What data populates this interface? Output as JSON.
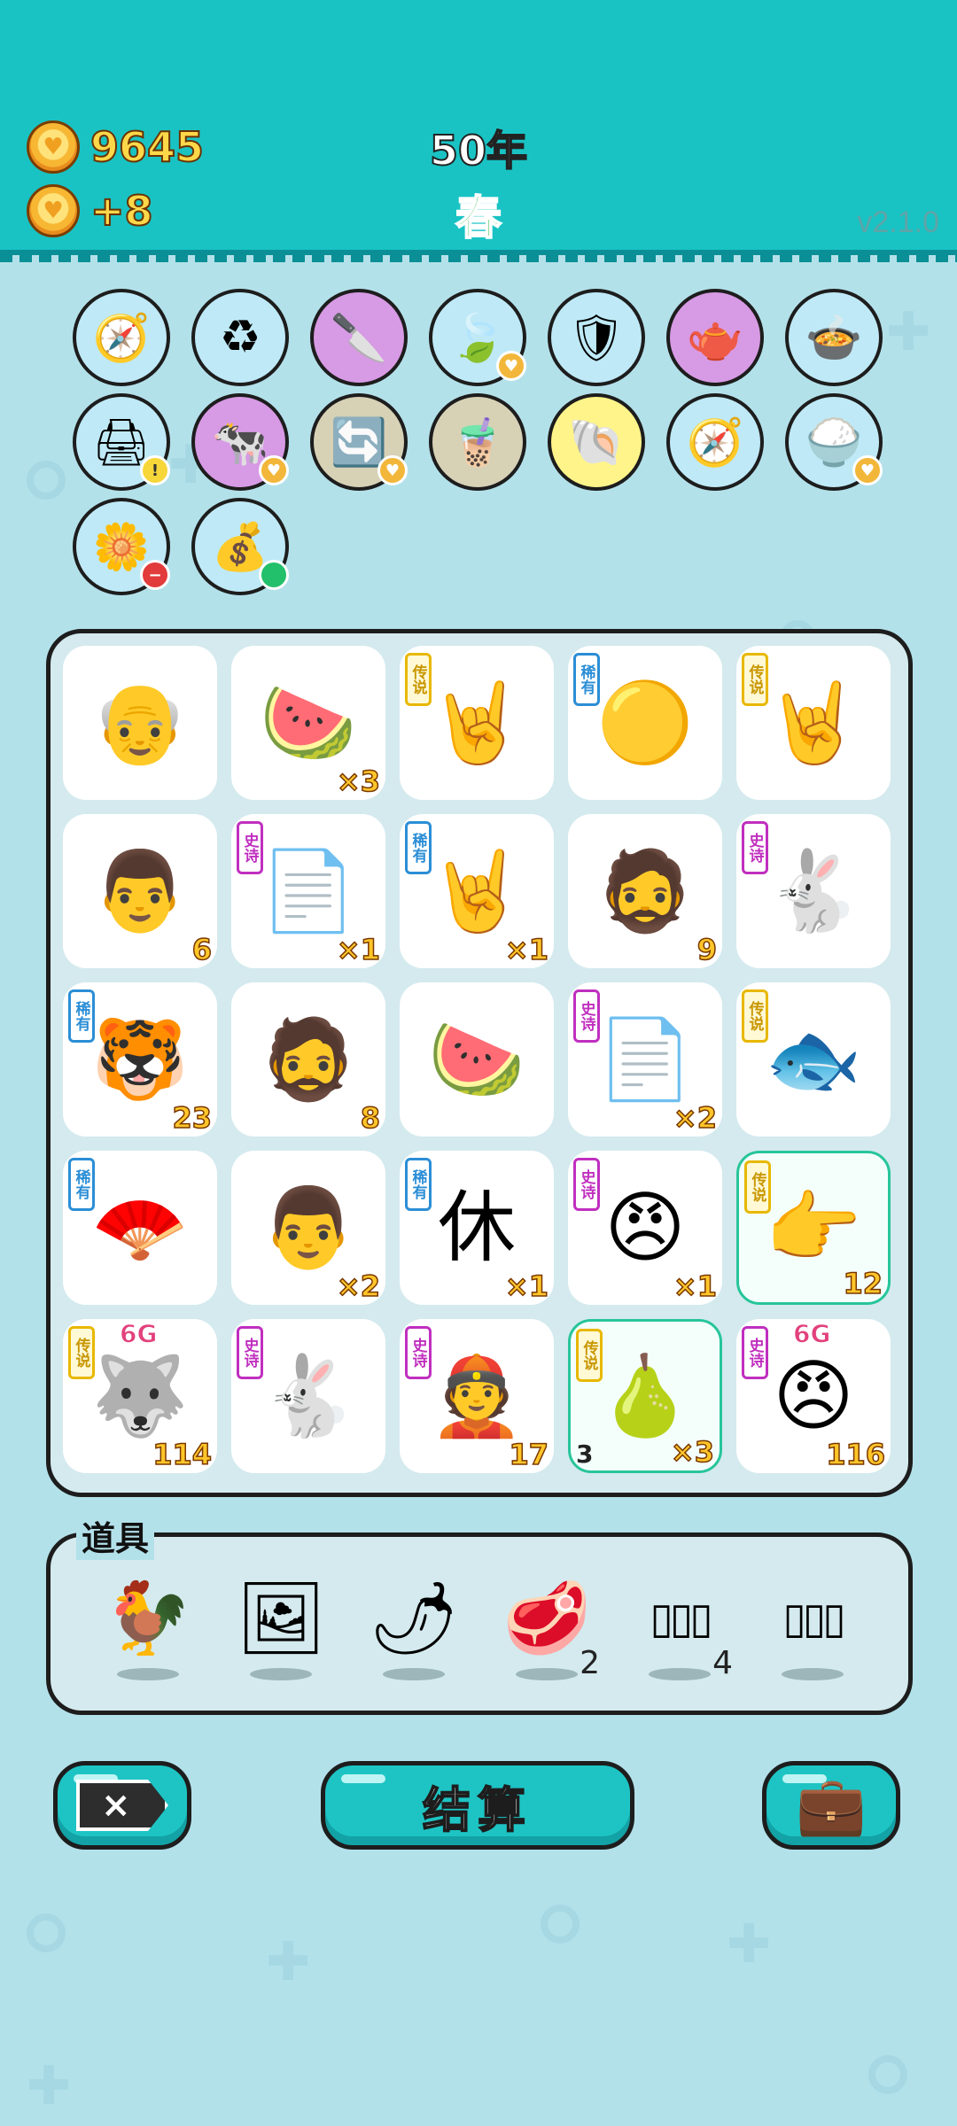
{
  "header": {
    "coins": "9645",
    "income": "+8",
    "year": "50年",
    "season": "春",
    "version": "v2.1.0"
  },
  "tools_row1": [
    {
      "icon": "compass-icon",
      "glyph": "🧭",
      "color": "c-blue"
    },
    {
      "icon": "trash-bag-recycle-icon",
      "glyph": "♻",
      "color": "c-blue"
    },
    {
      "icon": "cleaver-icon",
      "glyph": "🔪",
      "color": "c-purple"
    },
    {
      "icon": "leaf-icon",
      "glyph": "🍃",
      "color": "c-blue",
      "badge": "heart"
    },
    {
      "icon": "shield-wrench-icon",
      "glyph": "🛡",
      "color": "c-blue"
    },
    {
      "icon": "gravy-boat-icon",
      "glyph": "🫖",
      "color": "c-purple"
    },
    {
      "icon": "pot-duck-icon",
      "glyph": "🍲",
      "color": "c-blue"
    }
  ],
  "tools_row2": [
    {
      "icon": "printer-icon",
      "glyph": "🖨",
      "color": "c-blue",
      "badge": "warn"
    },
    {
      "icon": "cow-pair-icon",
      "glyph": "🐄",
      "color": "c-purple",
      "badge": "heart"
    },
    {
      "icon": "refresh-icon",
      "glyph": "🔄",
      "color": "c-tan",
      "badge": "heart"
    },
    {
      "icon": "bubble-tea-icon",
      "glyph": "🧋",
      "color": "c-tan"
    },
    {
      "icon": "shell-icon",
      "glyph": "🐚",
      "color": "c-yellow"
    },
    {
      "icon": "compass-icon",
      "glyph": "🧭",
      "color": "c-blue"
    },
    {
      "icon": "rice-bowl-icon",
      "glyph": "🍚",
      "color": "c-blue",
      "badge": "heart"
    }
  ],
  "tools_row3": [
    {
      "icon": "potted-flower-icon",
      "glyph": "🌼",
      "color": "c-blue",
      "badge": "minus"
    },
    {
      "icon": "money-bag-icon",
      "glyph": "💰",
      "color": "c-blue",
      "badge": "green"
    }
  ],
  "board": [
    [
      {
        "name": "old-man-glasses",
        "glyph": "👴",
        "tag": "",
        "count": ""
      },
      {
        "name": "watermelon-crossed",
        "glyph": "🍉",
        "tag": "",
        "count": "×3"
      },
      {
        "name": "rock-hand",
        "glyph": "🤘",
        "tag": "传说",
        "tagclass": "t-leg",
        "count": ""
      },
      {
        "name": "gold-pentagon",
        "glyph": "🟡",
        "tag": "稀有",
        "tagclass": "t-rare",
        "count": ""
      },
      {
        "name": "rock-hand-2",
        "glyph": "🤘",
        "tag": "传说",
        "tagclass": "t-leg",
        "count": ""
      }
    ],
    [
      {
        "name": "man-black-hair",
        "glyph": "👨",
        "tag": "",
        "count": "6"
      },
      {
        "name": "ctrl-cv",
        "glyph": "📄",
        "tag": "史诗",
        "tagclass": "t-epic",
        "count": "×1"
      },
      {
        "name": "brown-hand",
        "glyph": "🤘",
        "tag": "稀有",
        "tagclass": "t-rare",
        "count": "×1"
      },
      {
        "name": "worker-red-cap",
        "glyph": "🧔",
        "tag": "",
        "count": "9"
      },
      {
        "name": "rabbit-tent",
        "glyph": "🐇",
        "tag": "史诗",
        "tagclass": "t-epic",
        "count": ""
      }
    ],
    [
      {
        "name": "tiger-cat",
        "glyph": "🐯",
        "tag": "稀有",
        "tagclass": "t-rare",
        "count": "23"
      },
      {
        "name": "worker-red-cap-2",
        "glyph": "🧔",
        "tag": "",
        "count": "8"
      },
      {
        "name": "watermelon",
        "glyph": "🍉",
        "tag": "",
        "count": ""
      },
      {
        "name": "ctrl-cv-2",
        "glyph": "📄",
        "tag": "史诗",
        "tagclass": "t-epic",
        "count": "×2"
      },
      {
        "name": "koi-fish",
        "glyph": "🐟",
        "tag": "传说",
        "tagclass": "t-leg",
        "count": ""
      }
    ],
    [
      {
        "name": "fan-crossed",
        "glyph": "🪭",
        "tag": "稀有",
        "tagclass": "t-rare",
        "count": ""
      },
      {
        "name": "man-crossed",
        "glyph": "👨",
        "tag": "",
        "count": "×2"
      },
      {
        "name": "rest-text",
        "glyph": "休",
        "tag": "稀有",
        "tagclass": "t-rare",
        "count": "×1"
      },
      {
        "name": "grumpy-man",
        "glyph": "😠",
        "tag": "史诗",
        "tagclass": "t-epic",
        "count": "×1"
      },
      {
        "name": "pointing-hand",
        "glyph": "👉",
        "tag": "传说",
        "tagclass": "t-leg",
        "count": "12",
        "hl": true
      }
    ],
    [
      {
        "name": "husky-crown",
        "glyph": "🐺",
        "tag": "传说",
        "tagclass": "t-leg",
        "count": "114",
        "g": "6G"
      },
      {
        "name": "rabbit-tent-2",
        "glyph": "🐇",
        "tag": "史诗",
        "tagclass": "t-epic",
        "count": ""
      },
      {
        "name": "farmer-hat",
        "glyph": "👲",
        "tag": "史诗",
        "tagclass": "t-epic",
        "count": "17"
      },
      {
        "name": "pear",
        "glyph": "🍐",
        "tag": "传说",
        "tagclass": "t-leg",
        "count": "×3",
        "lcount": "3",
        "hl": true
      },
      {
        "name": "grumpy-man-2",
        "glyph": "😠",
        "tag": "史诗",
        "tagclass": "t-epic",
        "count": "116",
        "g": "6G"
      }
    ]
  ],
  "items_section": {
    "title": "道具",
    "items": [
      {
        "name": "white-chicken",
        "glyph": "🐓",
        "num": ""
      },
      {
        "name": "portrait-frame",
        "glyph": "🖼",
        "num": ""
      },
      {
        "name": "red-pepper",
        "glyph": "🌶",
        "num": ""
      },
      {
        "name": "liver",
        "glyph": "🥩",
        "num": "2"
      },
      {
        "name": "three-slots",
        "glyph": "▯▯▯",
        "num": "4"
      },
      {
        "name": "three-slots-rare",
        "glyph": "▯▯▯",
        "num": ""
      }
    ]
  },
  "buttons": {
    "exit_glyph": "×",
    "settle_label": "结算",
    "bag_glyph": "💼"
  }
}
